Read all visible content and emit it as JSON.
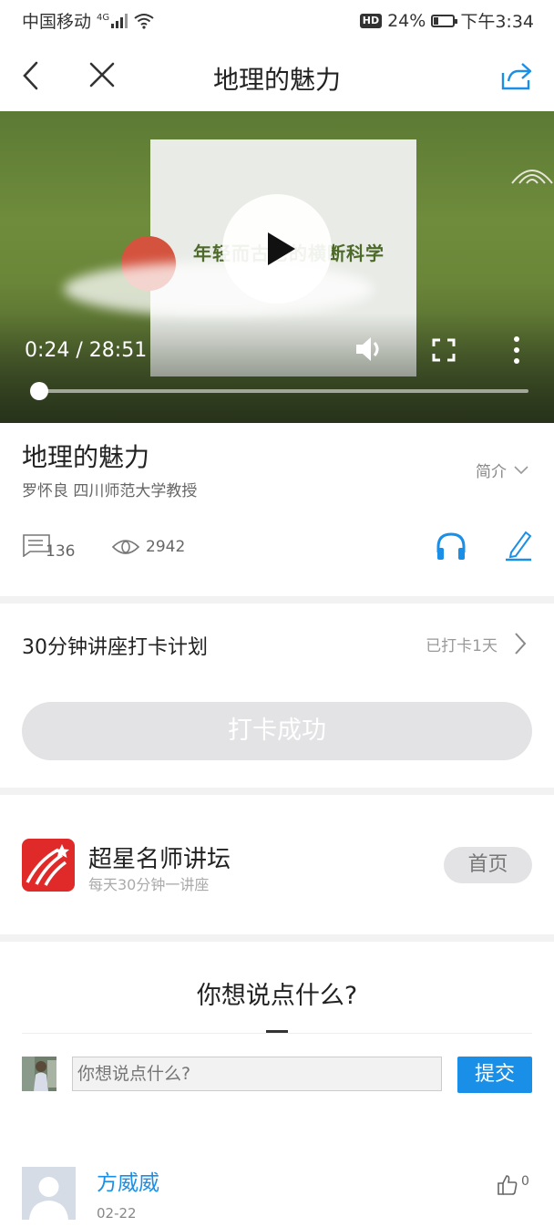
{
  "status_bar": {
    "carrier": "中国移动",
    "network": "4G",
    "hd": "HD",
    "battery": "24%",
    "battery_level": 0.24,
    "time": "下午3:34"
  },
  "nav": {
    "title": "地理的魅力"
  },
  "video": {
    "slide_text": "年轻而古老的横断科学",
    "time_display": "0:24 / 28:51",
    "progress": 0.014
  },
  "lecture": {
    "title": "地理的魅力",
    "author": "罗怀良  四川师范大学教授",
    "intro_label": "简介",
    "comment_count": "136",
    "view_count": "2942"
  },
  "plan": {
    "title": "30分钟讲座打卡计划",
    "status": "已打卡1天",
    "button": "打卡成功"
  },
  "channel": {
    "name": "超星名师讲坛",
    "subtitle": "每天30分钟一讲座",
    "home_button": "首页"
  },
  "comment_box": {
    "heading": "你想说点什么?",
    "placeholder": "你想说点什么?",
    "submit": "提交"
  },
  "comments": [
    {
      "name": "方威威",
      "date": "02-22",
      "likes": "0"
    }
  ],
  "colors": {
    "accent": "#1a8fe8",
    "logo_red": "#e02a2a",
    "disabled_button": "#e3e3e5"
  }
}
